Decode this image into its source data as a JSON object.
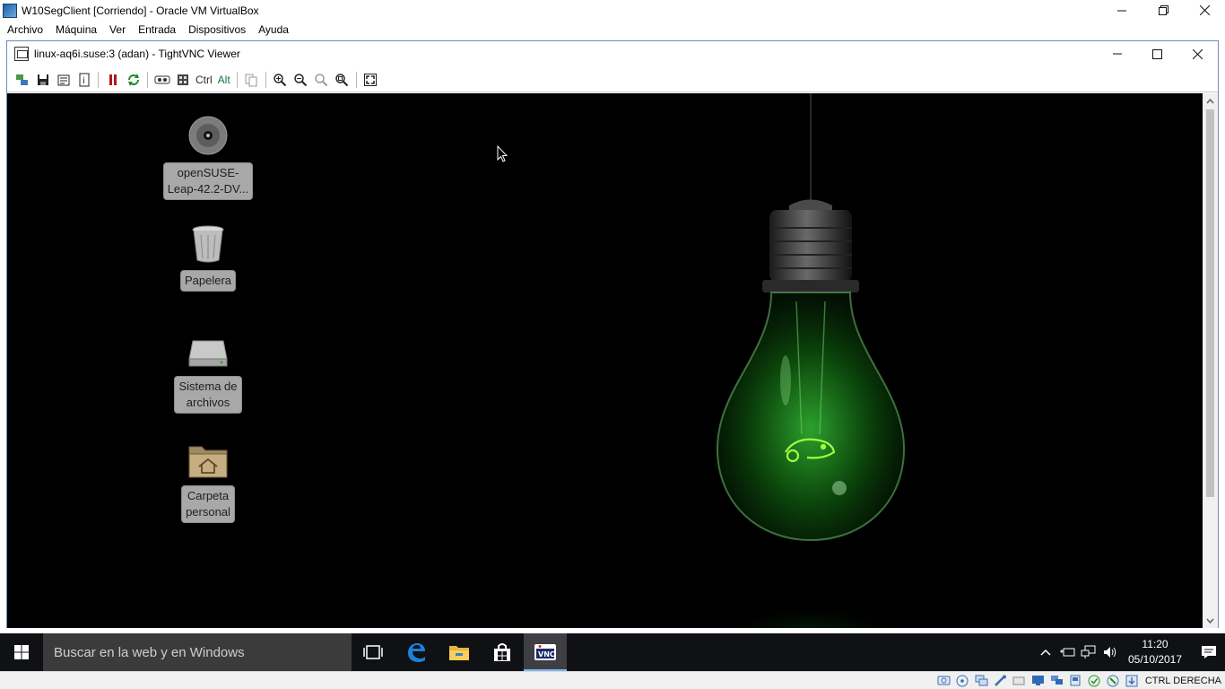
{
  "vbox": {
    "title": "W10SegClient [Corriendo] - Oracle VM VirtualBox",
    "menu": [
      "Archivo",
      "Máquina",
      "Ver",
      "Entrada",
      "Dispositivos",
      "Ayuda"
    ],
    "status_hostkey": "CTRL DERECHA"
  },
  "vnc": {
    "title": "linux-aq6i.suse:3 (adan) - TightVNC Viewer",
    "toolbar_ctrl": "Ctrl",
    "toolbar_alt": "Alt"
  },
  "desktop": {
    "icons": [
      {
        "label_line1": "openSUSE-",
        "label_line2": "Leap-42.2-DV..."
      },
      {
        "label_line1": "Papelera",
        "label_line2": ""
      },
      {
        "label_line1": "Sistema de",
        "label_line2": "archivos"
      },
      {
        "label_line1": "Carpeta",
        "label_line2": "personal"
      }
    ]
  },
  "taskbar": {
    "search_placeholder": "Buscar en la web y en Windows",
    "time": "11:20",
    "date": "05/10/2017"
  },
  "colors": {
    "taskbar_bg": "#0f1114",
    "search_bg": "#3b3b3b",
    "bulb_green": "#3adb3a",
    "label_bg": "#a8a8a8"
  }
}
